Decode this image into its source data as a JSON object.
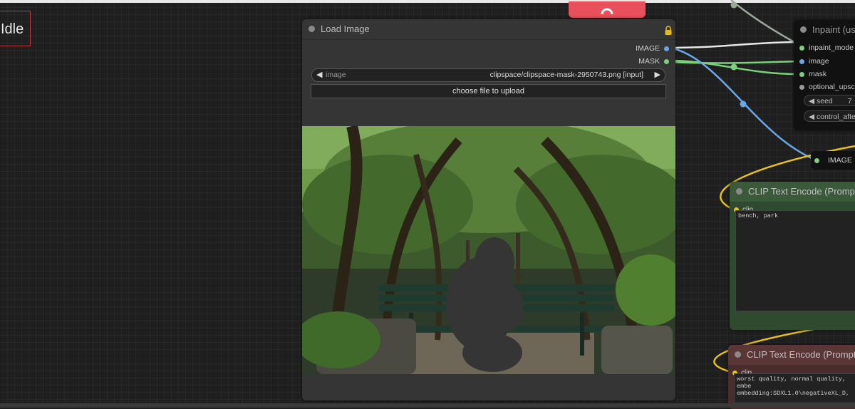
{
  "status": {
    "text": "Idle"
  },
  "load_image_node": {
    "title": "Load Image",
    "outputs": [
      {
        "label": "IMAGE",
        "color": "#6aa7e8"
      },
      {
        "label": "MASK",
        "color": "#7bd27b"
      }
    ],
    "image_widget": {
      "label": "image",
      "value": "clipspace/clipspace-mask-2950743.png [input]"
    },
    "upload_button": "choose file to upload"
  },
  "inpaint_node": {
    "title": "Inpaint (us",
    "inputs": [
      {
        "label": "inpaint_mode",
        "color": "#7bd27b"
      },
      {
        "label": "image",
        "color": "#6aa7e8"
      },
      {
        "label": "mask",
        "color": "#7bd27b"
      },
      {
        "label": "optional_upsc",
        "color": "#9a9a9a"
      }
    ],
    "seed_label": "seed",
    "seed_value": "7",
    "control_label": "control_afte"
  },
  "reroute_node": {
    "label": "IMAGE"
  },
  "clip_positive": {
    "title": "CLIP Text Encode (Prompt",
    "input": "clip",
    "text": "bench, park"
  },
  "clip_negative": {
    "title": "CLIP Text Encode (Prompt",
    "input": "clip",
    "text_line1": "worst quality, normal quality, embe",
    "text_line2": "embedding:SDXL1.0\\negativeXL_D,"
  },
  "colors": {
    "queue_button": "#e8505b",
    "image_link": "#6aa7e8",
    "mask_link": "#7bd27b",
    "clip_link": "#e8c21a",
    "positive_node": "#2f4a2f",
    "negative_node": "#4a2c2c"
  }
}
